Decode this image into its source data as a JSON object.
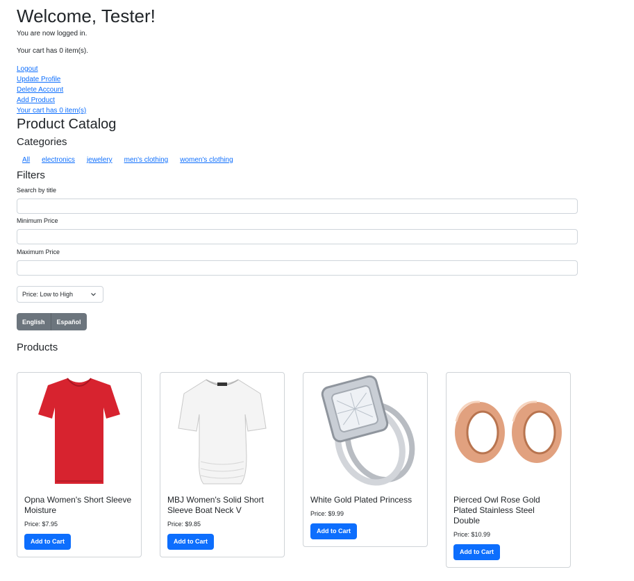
{
  "header": {
    "welcome": "Welcome, Tester!",
    "logged_in": "You are now logged in.",
    "cart_status": "Your cart has 0 item(s)."
  },
  "links": {
    "logout": "Logout",
    "update_profile": "Update Profile",
    "delete_account": "Delete Account",
    "add_product": "Add Product",
    "cart": "Your cart has 0 item(s)"
  },
  "catalog": {
    "title": "Product Catalog",
    "categories_heading": "Categories",
    "categories": [
      "All",
      "electronics",
      "jewelery",
      "men's clothing",
      "women's clothing"
    ]
  },
  "filters": {
    "heading": "Filters",
    "search_label": "Search by title",
    "search_value": "",
    "min_label": "Minimum Price",
    "min_value": "",
    "max_label": "Maximum Price",
    "max_value": "",
    "sort_selected": "Price: Low to High"
  },
  "language": {
    "english": "English",
    "spanish": "Español"
  },
  "products": {
    "heading": "Products",
    "add_label": "Add to Cart",
    "items": [
      {
        "title": "Opna Women's Short Sleeve Moisture",
        "price": "Price: $7.95",
        "image": "red-tshirt"
      },
      {
        "title": "MBJ Women's Solid Short Sleeve Boat Neck V",
        "price": "Price: $9.85",
        "image": "white-top"
      },
      {
        "title": "White Gold Plated Princess",
        "price": "Price: $9.99",
        "image": "diamond-ring"
      },
      {
        "title": "Pierced Owl Rose Gold Plated Stainless Steel Double",
        "price": "Price: $10.99",
        "image": "rose-gold-tunnels"
      }
    ]
  },
  "colors": {
    "link": "#0d6efd",
    "primary_button": "#0d6efd",
    "secondary_button": "#6c757d"
  }
}
